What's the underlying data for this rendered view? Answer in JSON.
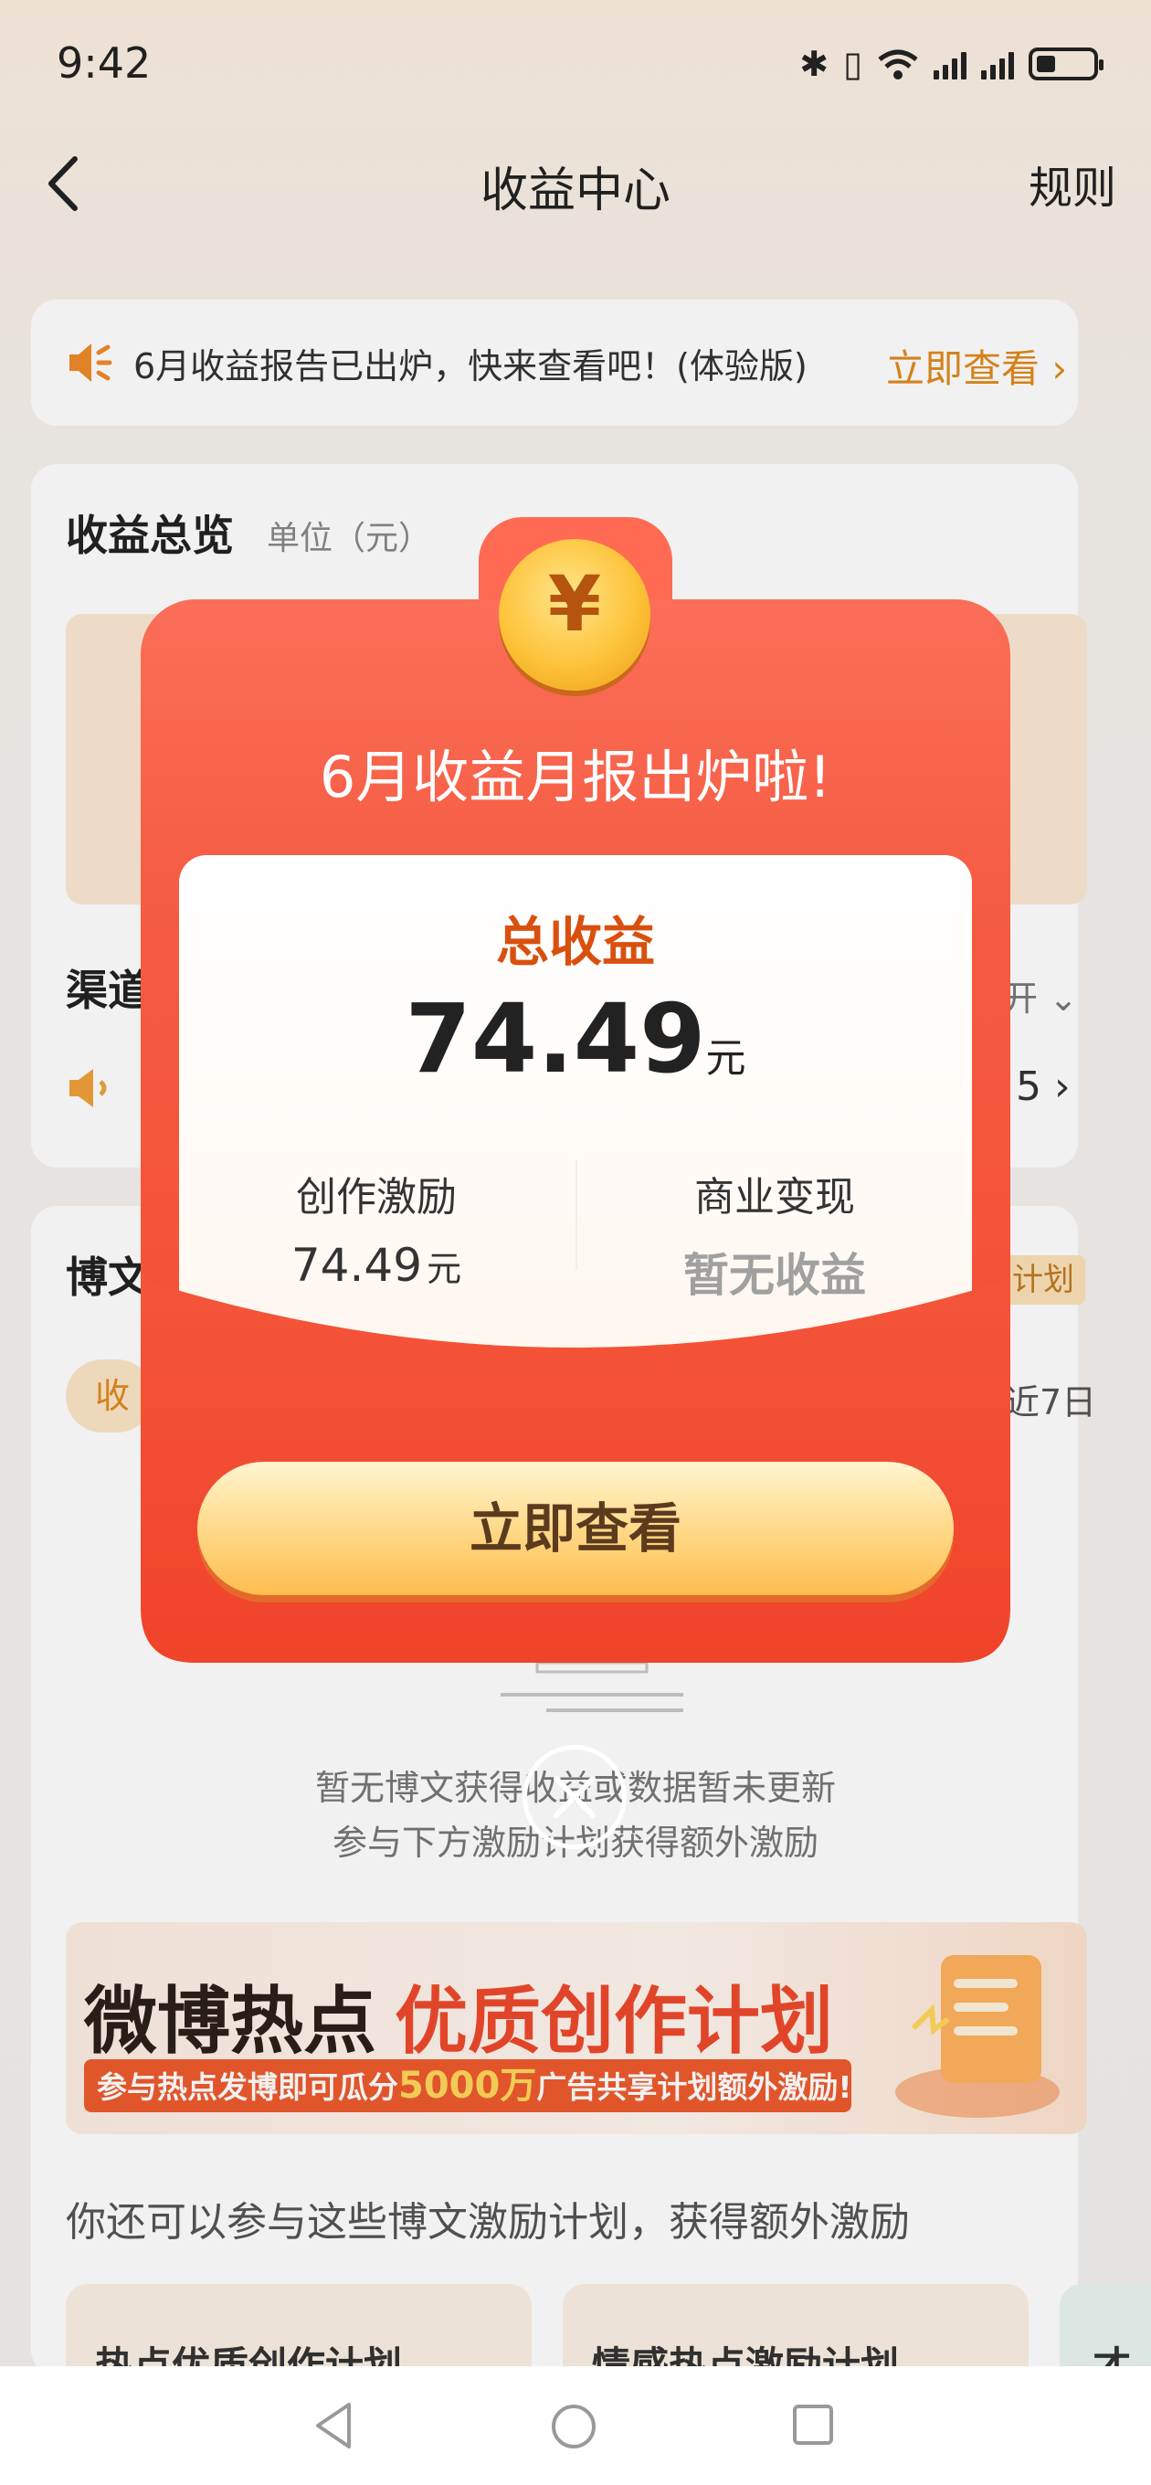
{
  "status_bar": {
    "time": "9:42"
  },
  "nav": {
    "title": "收益中心",
    "rules": "规则"
  },
  "notice": {
    "text": "6月收益报告已出炉，快来查看吧！(体验版)",
    "link": "立即查看"
  },
  "overview": {
    "title": "收益总览",
    "unit": "单位（元）"
  },
  "channel": {
    "label": "渠道",
    "expand": "开",
    "value": "5"
  },
  "blog": {
    "title": "博文",
    "badge": "计划",
    "pill": "收益",
    "period": "近7日"
  },
  "empty_state": {
    "line1": "暂无博文获得收益或数据暂未更新",
    "line2": "参与下方激励计划获得额外激励"
  },
  "banner": {
    "title_dark": "微博热点",
    "title_red": "优质创作计划",
    "sub_prefix": "参与热点发博即可瓜分",
    "sub_highlight": "5000万",
    "sub_suffix": "广告共享计划额外激励!"
  },
  "more_text": "你还可以参与这些博文激励计划，获得额外激励",
  "plan_cards": [
    "热点优质创作计划",
    "情感热点激励计划",
    "才"
  ],
  "popup": {
    "coin_symbol": "¥",
    "title": "6月收益月报出炉啦!",
    "total_label": "总收益",
    "total_value": "74.49",
    "total_unit": "元",
    "incentive_label": "创作激励",
    "incentive_value": "74.49",
    "incentive_unit": "元",
    "business_label": "商业变现",
    "business_value": "暂无收益",
    "cta": "立即查看"
  },
  "colors": {
    "accent": "#e08a1c",
    "popup_red": "#f24a30",
    "total_label": "#d9500e"
  }
}
